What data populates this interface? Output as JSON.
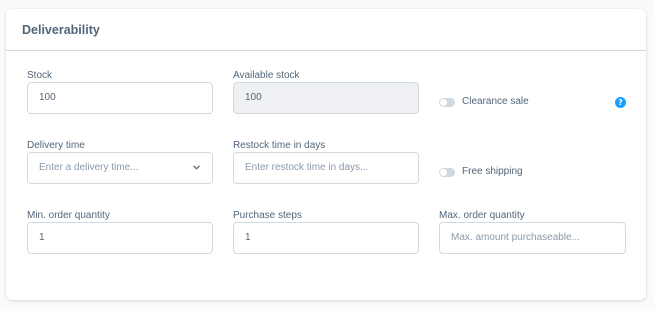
{
  "card": {
    "title": "Deliverability"
  },
  "fields": {
    "stock": {
      "label": "Stock",
      "value": "100"
    },
    "available_stock": {
      "label": "Available stock",
      "value": "100"
    },
    "delivery_time": {
      "label": "Delivery time",
      "placeholder": "Enter a delivery time..."
    },
    "restock_time": {
      "label": "Restock time in days",
      "placeholder": "Enter restock time in days..."
    },
    "min_order_quantity": {
      "label": "Min. order quantity",
      "value": "1"
    },
    "purchase_steps": {
      "label": "Purchase steps",
      "value": "1"
    },
    "max_order_quantity": {
      "label": "Max. order quantity",
      "placeholder": "Max. amount purchaseable..."
    }
  },
  "toggles": {
    "clearance_sale": {
      "label": "Clearance sale",
      "checked": false
    },
    "free_shipping": {
      "label": "Free shipping",
      "checked": false
    }
  },
  "help": {
    "icon": "help-icon",
    "glyph": "?"
  },
  "colors": {
    "text": "#52667a",
    "border": "#d1d9e0",
    "accent": "#189eff",
    "disabled_bg": "#eef0f3"
  }
}
